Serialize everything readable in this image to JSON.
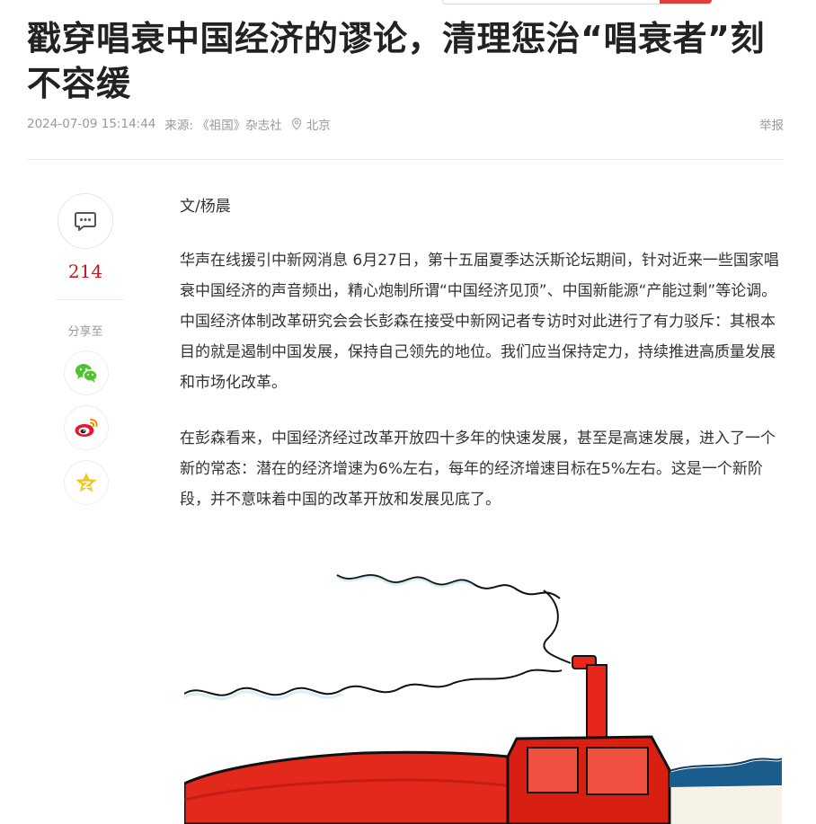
{
  "article": {
    "title": "戳穿唱衰中国经济的谬论，清理惩治“唱衰者”刻不容缓",
    "date": "2024-07-09 15:14:44",
    "source": "来源: 《祖国》杂志社",
    "location": "北京",
    "report_label": "举报",
    "author": "文/杨晨",
    "paragraphs": [
      "华声在线援引中新网消息 6月27日，第十五届夏季达沃斯论坛期间，针对近来一些国家唱衰中国经济的声音频出，精心炮制所谓“中国经济见顶”、中国新能源“产能过剩”等论调。中国经济体制改革研究会会长彭森在接受中新网记者专访时对此进行了有力驳斥：其根本目的就是遏制中国发展，保持自己领先的地位。我们应当保持定力，持续推进高质量发展和市场化改革。",
      "在彭森看来，中国经济经过改革开放四十多年的快速发展，甚至是高速发展，进入了一个新的常态：潜在的经济增速为6%左右，每年的经济增速目标在5%左右。这是一个新阶段，并不意味着中国的改革开放和发展见底了。"
    ]
  },
  "sidebar": {
    "comment_count": "214",
    "share_label": "分享至",
    "share_icons": [
      "wechat-icon",
      "weibo-icon",
      "qzone-star-icon"
    ]
  },
  "colors": {
    "accent_red": "#c8161d",
    "wechat_green": "#51c332",
    "weibo_red": "#e6162d",
    "qzone_yellow": "#f5c518"
  }
}
